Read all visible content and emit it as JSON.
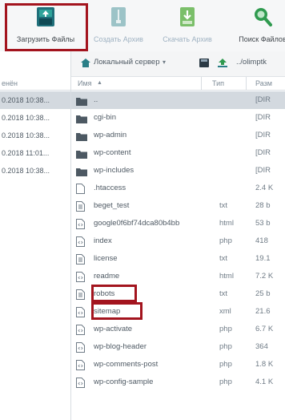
{
  "toolbar": {
    "upload_label": "Загрузить Файлы",
    "create_archive_label": "Создать Архив",
    "extract_archive_label": "Скачать Архив",
    "search_label": "Поиск Файлов"
  },
  "pathbar": {
    "server_label": "Локальный сервер",
    "path": "../olimptk"
  },
  "left_panel": {
    "column_header": "енён",
    "rows": [
      "0.2018 10:38...",
      "0.2018 10:38...",
      "0.2018 10:38...",
      "0.2018 11:01...",
      "0.2018 10:38..."
    ]
  },
  "file_list": {
    "headers": {
      "name": "Имя",
      "type": "Тип",
      "size": "Разм"
    },
    "rows": [
      {
        "name": "..",
        "type": "",
        "size": "[DIR",
        "icon": "folder-icon"
      },
      {
        "name": "cgi-bin",
        "type": "",
        "size": "[DIR",
        "icon": "folder-icon"
      },
      {
        "name": "wp-admin",
        "type": "",
        "size": "[DIR",
        "icon": "folder-icon"
      },
      {
        "name": "wp-content",
        "type": "",
        "size": "[DIR",
        "icon": "folder-icon"
      },
      {
        "name": "wp-includes",
        "type": "",
        "size": "[DIR",
        "icon": "folder-icon"
      },
      {
        "name": ".htaccess",
        "type": "",
        "size": "2.4 K",
        "icon": "blank-file-icon"
      },
      {
        "name": "beget_test",
        "type": "txt",
        "size": "28 b",
        "icon": "text-file-icon"
      },
      {
        "name": "google0f6bf74dca80b4bb",
        "type": "html",
        "size": "53 b",
        "icon": "code-file-icon"
      },
      {
        "name": "index",
        "type": "php",
        "size": "418",
        "icon": "code-file-icon"
      },
      {
        "name": "license",
        "type": "txt",
        "size": "19.1",
        "icon": "text-file-icon"
      },
      {
        "name": "readme",
        "type": "html",
        "size": "7.2 K",
        "icon": "code-file-icon"
      },
      {
        "name": "robots",
        "type": "txt",
        "size": "25 b",
        "icon": "text-file-icon"
      },
      {
        "name": "sitemap",
        "type": "xml",
        "size": "21.6",
        "icon": "code-file-icon"
      },
      {
        "name": "wp-activate",
        "type": "php",
        "size": "6.7 K",
        "icon": "code-file-icon"
      },
      {
        "name": "wp-blog-header",
        "type": "php",
        "size": "364",
        "icon": "code-file-icon"
      },
      {
        "name": "wp-comments-post",
        "type": "php",
        "size": "1.8 K",
        "icon": "code-file-icon"
      },
      {
        "name": "wp-config-sample",
        "type": "php",
        "size": "4.1 K",
        "icon": "code-file-icon"
      }
    ]
  },
  "colors": {
    "highlight": "#a3141e",
    "selected_row": "#d3d9df",
    "toolbar_bg": "#f6f7f8"
  }
}
